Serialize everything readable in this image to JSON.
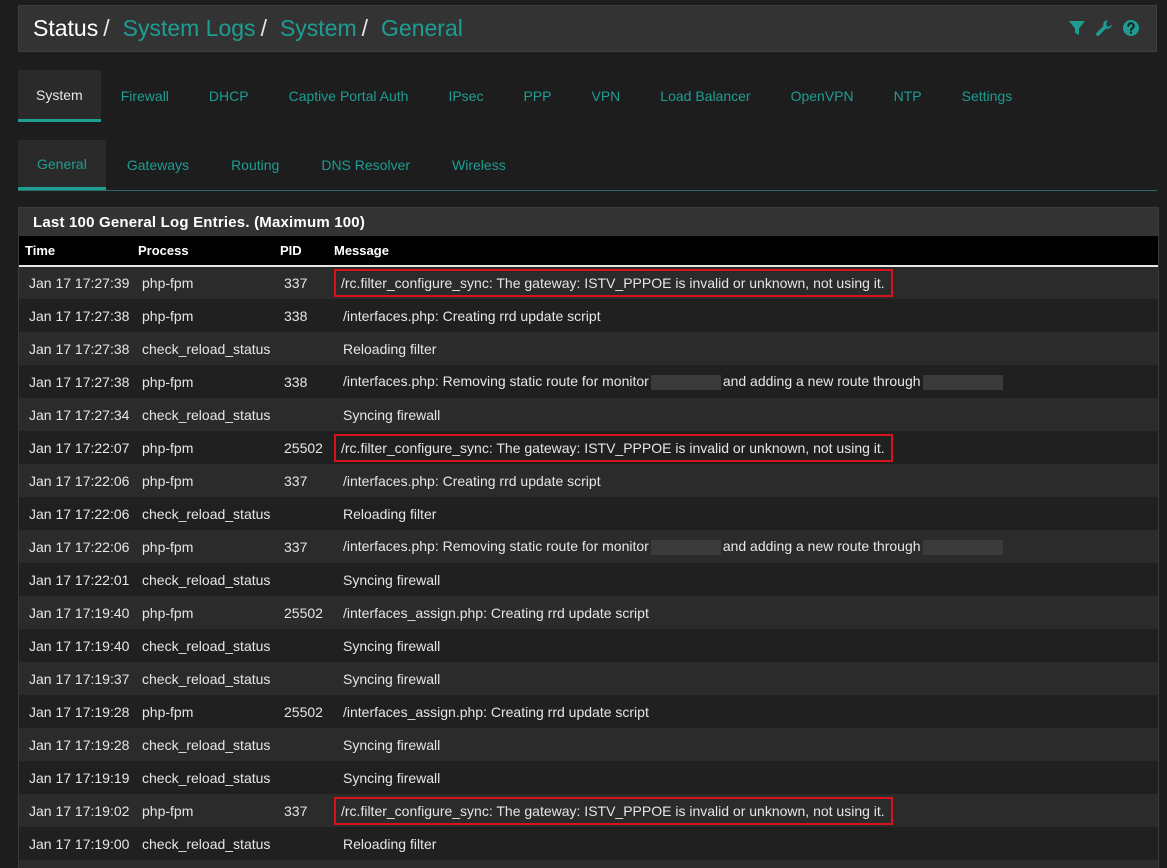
{
  "breadcrumb": [
    "Status",
    "System Logs",
    "System",
    "General"
  ],
  "header_icons": [
    "filter-icon",
    "wrench-icon",
    "help-icon"
  ],
  "colors": {
    "accent": "#1e9d93",
    "highlight": "#d4141c",
    "background": "#1d1d1d"
  },
  "tabs": [
    "System",
    "Firewall",
    "DHCP",
    "Captive Portal Auth",
    "IPsec",
    "PPP",
    "VPN",
    "Load Balancer",
    "OpenVPN",
    "NTP",
    "Settings"
  ],
  "active_tab": "System",
  "subtabs": [
    "General",
    "Gateways",
    "Routing",
    "DNS Resolver",
    "Wireless"
  ],
  "active_subtab": "General",
  "panel": {
    "title": "Last 100 General Log Entries. (Maximum 100)"
  },
  "columns": [
    "Time",
    "Process",
    "PID",
    "Message"
  ],
  "rows": [
    {
      "time": "Jan 17 17:27:39",
      "process": "php-fpm",
      "pid": "337",
      "message": "/rc.filter_configure_sync: The gateway: ISTV_PPPOE is invalid or unknown, not using it.",
      "highlight": true
    },
    {
      "time": "Jan 17 17:27:38",
      "process": "php-fpm",
      "pid": "338",
      "message": "/interfaces.php: Creating rrd update script"
    },
    {
      "time": "Jan 17 17:27:38",
      "process": "check_reload_status",
      "pid": "",
      "message": "Reloading filter"
    },
    {
      "time": "Jan 17 17:27:38",
      "process": "php-fpm",
      "pid": "338",
      "message_parts": [
        "/interfaces.php: Removing static route for monitor",
        "and adding a new route through"
      ]
    },
    {
      "time": "Jan 17 17:27:34",
      "process": "check_reload_status",
      "pid": "",
      "message": "Syncing firewall"
    },
    {
      "time": "Jan 17 17:22:07",
      "process": "php-fpm",
      "pid": "25502",
      "message": "/rc.filter_configure_sync: The gateway: ISTV_PPPOE is invalid or unknown, not using it.",
      "highlight": true
    },
    {
      "time": "Jan 17 17:22:06",
      "process": "php-fpm",
      "pid": "337",
      "message": "/interfaces.php: Creating rrd update script"
    },
    {
      "time": "Jan 17 17:22:06",
      "process": "check_reload_status",
      "pid": "",
      "message": "Reloading filter"
    },
    {
      "time": "Jan 17 17:22:06",
      "process": "php-fpm",
      "pid": "337",
      "message_parts": [
        "/interfaces.php: Removing static route for monitor",
        "and adding a new route through"
      ]
    },
    {
      "time": "Jan 17 17:22:01",
      "process": "check_reload_status",
      "pid": "",
      "message": "Syncing firewall"
    },
    {
      "time": "Jan 17 17:19:40",
      "process": "php-fpm",
      "pid": "25502",
      "message": "/interfaces_assign.php: Creating rrd update script"
    },
    {
      "time": "Jan 17 17:19:40",
      "process": "check_reload_status",
      "pid": "",
      "message": "Syncing firewall"
    },
    {
      "time": "Jan 17 17:19:37",
      "process": "check_reload_status",
      "pid": "",
      "message": "Syncing firewall"
    },
    {
      "time": "Jan 17 17:19:28",
      "process": "php-fpm",
      "pid": "25502",
      "message": "/interfaces_assign.php: Creating rrd update script"
    },
    {
      "time": "Jan 17 17:19:28",
      "process": "check_reload_status",
      "pid": "",
      "message": "Syncing firewall"
    },
    {
      "time": "Jan 17 17:19:19",
      "process": "check_reload_status",
      "pid": "",
      "message": "Syncing firewall"
    },
    {
      "time": "Jan 17 17:19:02",
      "process": "php-fpm",
      "pid": "337",
      "message": "/rc.filter_configure_sync: The gateway: ISTV_PPPOE is invalid or unknown, not using it.",
      "highlight": true
    },
    {
      "time": "Jan 17 17:19:00",
      "process": "check_reload_status",
      "pid": "",
      "message": "Reloading filter"
    },
    {
      "time": "",
      "process": "",
      "pid": "",
      "message": ""
    }
  ]
}
